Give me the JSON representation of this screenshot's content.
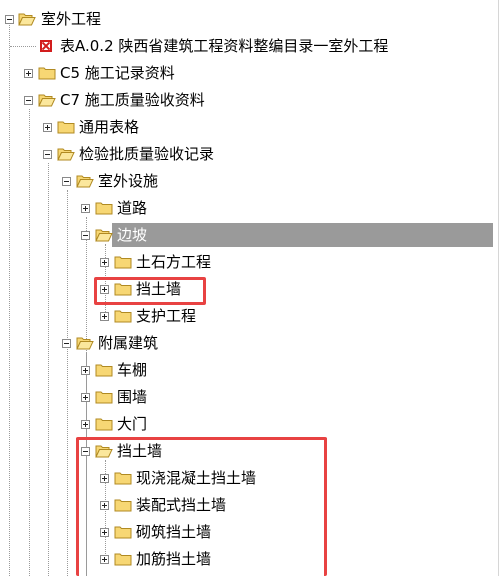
{
  "tree": {
    "nodes": [
      {
        "id": "n0",
        "label": "室外工程",
        "kind": "folder",
        "state": "expanded"
      },
      {
        "id": "n1",
        "label": "表A.0.2 陕西省建筑工程资料整编目录一室外工程",
        "kind": "document"
      },
      {
        "id": "n2",
        "label": "C5 施工记录资料",
        "kind": "folder",
        "state": "collapsed"
      },
      {
        "id": "n3",
        "label": "C7 施工质量验收资料",
        "kind": "folder",
        "state": "expanded"
      },
      {
        "id": "n4",
        "label": "通用表格",
        "kind": "folder",
        "state": "collapsed"
      },
      {
        "id": "n5",
        "label": "检验批质量验收记录",
        "kind": "folder",
        "state": "expanded"
      },
      {
        "id": "n6",
        "label": "室外设施",
        "kind": "folder",
        "state": "expanded"
      },
      {
        "id": "n7",
        "label": "道路",
        "kind": "folder",
        "state": "collapsed"
      },
      {
        "id": "n8",
        "label": "边坡",
        "kind": "folder",
        "state": "expanded",
        "selected": true
      },
      {
        "id": "n9",
        "label": "土石方工程",
        "kind": "folder",
        "state": "collapsed"
      },
      {
        "id": "n10",
        "label": "挡土墙",
        "kind": "folder",
        "state": "collapsed"
      },
      {
        "id": "n11",
        "label": "支护工程",
        "kind": "folder",
        "state": "collapsed"
      },
      {
        "id": "n12",
        "label": "附属建筑",
        "kind": "folder",
        "state": "expanded"
      },
      {
        "id": "n13",
        "label": "车棚",
        "kind": "folder",
        "state": "collapsed"
      },
      {
        "id": "n14",
        "label": "围墙",
        "kind": "folder",
        "state": "collapsed"
      },
      {
        "id": "n15",
        "label": "大门",
        "kind": "folder",
        "state": "collapsed"
      },
      {
        "id": "n16",
        "label": "挡土墙",
        "kind": "folder",
        "state": "expanded"
      },
      {
        "id": "n17",
        "label": "现浇混凝土挡土墙",
        "kind": "folder",
        "state": "collapsed"
      },
      {
        "id": "n18",
        "label": "装配式挡土墙",
        "kind": "folder",
        "state": "collapsed"
      },
      {
        "id": "n19",
        "label": "砌筑挡土墙",
        "kind": "folder",
        "state": "collapsed"
      },
      {
        "id": "n20",
        "label": "加筋挡土墙",
        "kind": "folder",
        "state": "collapsed"
      }
    ]
  },
  "colors": {
    "folder_fill": "#f7d774",
    "folder_stroke": "#b08a22",
    "selection": "#9a9a9a",
    "annotation_box": "#e84242",
    "document_icon": "#d21d1d"
  }
}
